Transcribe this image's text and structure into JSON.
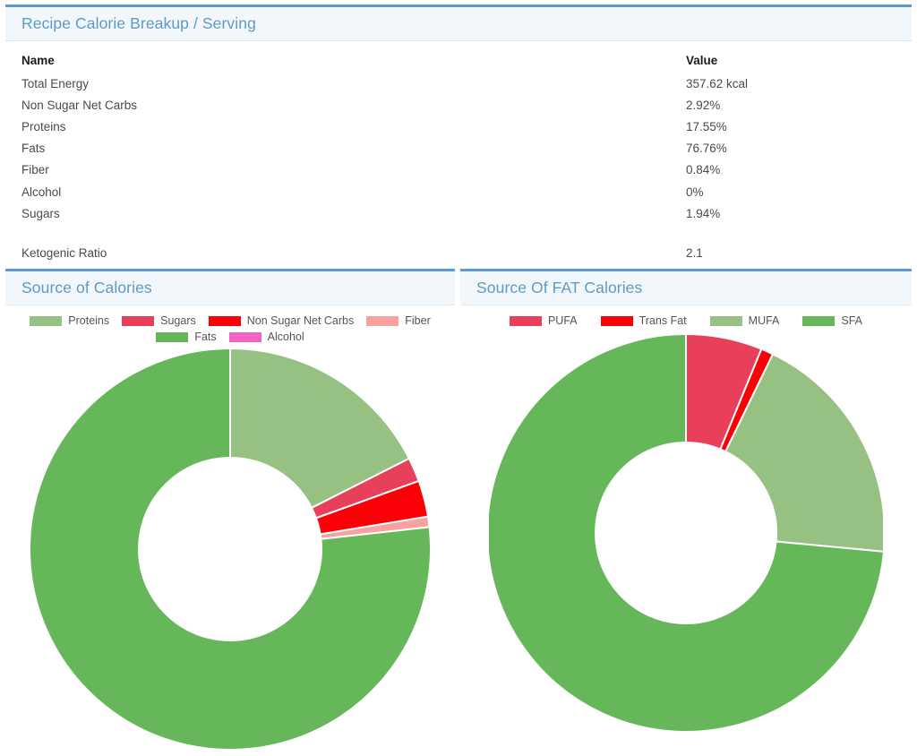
{
  "summary": {
    "title": "Recipe Calorie Breakup / Serving",
    "columns": {
      "name": "Name",
      "value": "Value"
    },
    "rows": [
      {
        "name": "Total Energy",
        "value": "357.62 kcal"
      },
      {
        "name": "Non Sugar Net Carbs",
        "value": "2.92%"
      },
      {
        "name": "Proteins",
        "value": "17.55%"
      },
      {
        "name": "Fats",
        "value": "76.76%"
      },
      {
        "name": "Fiber",
        "value": "0.84%"
      },
      {
        "name": "Alcohol",
        "value": "0%"
      },
      {
        "name": "Sugars",
        "value": "1.94%"
      }
    ],
    "footer_row": {
      "name": "Ketogenic Ratio",
      "value": "2.1"
    }
  },
  "colors": {
    "accent_border": "#5b9bd5",
    "header_bg": "#f2f7fb",
    "title_text": "#5f9ac4",
    "proteins": "#97c183",
    "sugars": "#e8405a",
    "non_sugar_net_carbs": "#fb0007",
    "fiber": "#f9a0a0",
    "fats": "#65b75a",
    "alcohol": "#f561c6",
    "pufa": "#e8405a",
    "trans_fat": "#fb0007",
    "mufa": "#97c183",
    "sfa": "#65b75a"
  },
  "chart_data": [
    {
      "type": "pie",
      "title": "Source of Calories",
      "donut": true,
      "legend_position": "top",
      "categories": [
        "Proteins",
        "Sugars",
        "Non Sugar Net Carbs",
        "Fiber",
        "Fats",
        "Alcohol"
      ],
      "values": [
        17.55,
        1.94,
        2.92,
        0.84,
        76.76,
        0
      ],
      "unit": "%",
      "colors": [
        "#97c183",
        "#e8405a",
        "#fb0007",
        "#f9a0a0",
        "#65b75a",
        "#f561c6"
      ]
    },
    {
      "type": "pie",
      "title": "Source Of FAT Calories",
      "donut": true,
      "legend_position": "top",
      "categories": [
        "PUFA",
        "Trans Fat",
        "MUFA",
        "SFA"
      ],
      "values": [
        6.2,
        1.0,
        19.3,
        73.5
      ],
      "unit": "%",
      "colors": [
        "#e8405a",
        "#fb0007",
        "#97c183",
        "#65b75a"
      ]
    }
  ]
}
